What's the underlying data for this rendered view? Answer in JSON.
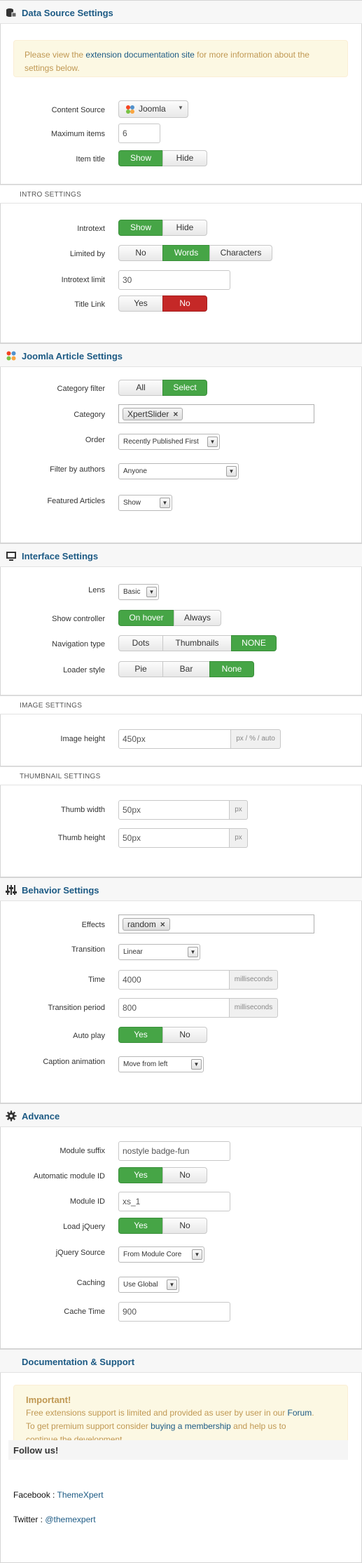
{
  "data_source": {
    "title": "Data Source Settings",
    "notice_pre": "Please view the",
    "notice_link": "extension documentation site",
    "notice_post_1": "for more information about the",
    "notice_post_2": "settings below.",
    "content_source_label": "Content Source",
    "content_source_value": "Joomla",
    "max_items_label": "Maximum items",
    "max_items_value": "6",
    "item_title_label": "Item title",
    "item_title_options": [
      "Show",
      "Hide"
    ],
    "item_title_selected": "Show"
  },
  "intro": {
    "title": "INTRO SETTINGS",
    "introtext_label": "Introtext",
    "introtext_options": [
      "Show",
      "Hide"
    ],
    "limited_by_label": "Limited by",
    "limited_by_options": [
      "No",
      "Words",
      "Characters"
    ],
    "limited_by_selected": "Words",
    "introtext_limit_label": "Introtext limit",
    "introtext_limit_value": "30",
    "title_link_label": "Title Link",
    "title_link_options": [
      "Yes",
      "No"
    ],
    "title_link_selected": "No"
  },
  "joomla": {
    "title": "Joomla Article Settings",
    "category_filter_label": "Category filter",
    "category_filter_options": [
      "All",
      "Select"
    ],
    "category_filter_selected": "Select",
    "category_label": "Category",
    "category_tag": "XpertSlider",
    "order_label": "Order",
    "order_value": "Recently Published First",
    "filter_authors_label": "Filter by authors",
    "filter_authors_value": "Anyone",
    "featured_label": "Featured Articles",
    "featured_value": "Show"
  },
  "interface": {
    "title": "Interface Settings",
    "lens_label": "Lens",
    "lens_value": "Basic",
    "show_controller_label": "Show controller",
    "show_controller_options": [
      "On hover",
      "Always"
    ],
    "show_controller_selected": "On hover",
    "navigation_label": "Navigation type",
    "navigation_options": [
      "Dots",
      "Thumbnails",
      "NONE"
    ],
    "navigation_selected": "NONE",
    "loader_label": "Loader style",
    "loader_options": [
      "Pie",
      "Bar",
      "None"
    ],
    "loader_selected": "None"
  },
  "image": {
    "title": "IMAGE SETTINGS",
    "height_label": "Image height",
    "height_value": "450px",
    "height_unit": "px / % / auto"
  },
  "thumbnail": {
    "title": "THUMBNAIL SETTINGS",
    "width_label": "Thumb width",
    "width_value": "50px",
    "width_unit": "px",
    "height_label": "Thumb height",
    "height_value": "50px",
    "height_unit": "px"
  },
  "behavior": {
    "title": "Behavior Settings",
    "effects_label": "Effects",
    "effects_tag": "random",
    "transition_label": "Transition",
    "transition_value": "Linear",
    "time_label": "Time",
    "time_value": "4000",
    "time_unit": "milliseconds",
    "period_label": "Transition period",
    "period_value": "800",
    "period_unit": "milliseconds",
    "autoplay_label": "Auto play",
    "autoplay_options": [
      "Yes",
      "No"
    ],
    "autoplay_selected": "Yes",
    "caption_label": "Caption animation",
    "caption_value": "Move from left"
  },
  "advance": {
    "title": "Advance",
    "suffix_label": "Module suffix",
    "suffix_value": "nostyle badge-fun",
    "auto_id_label": "Automatic module ID",
    "auto_id_options": [
      "Yes",
      "No"
    ],
    "module_id_label": "Module ID",
    "module_id_value": "xs_1",
    "load_jquery_label": "Load jQuery",
    "load_jquery_options": [
      "Yes",
      "No"
    ],
    "jquery_source_label": "jQuery Source",
    "jquery_source_value": "From Module Core",
    "caching_label": "Caching",
    "caching_value": "Use Global",
    "cache_time_label": "Cache Time",
    "cache_time_value": "900"
  },
  "docs": {
    "title": "Documentation & Support",
    "important": "Important!",
    "line1_pre": "Free extensions support is limited and provided as user by user in our",
    "line1_link": "Forum",
    "line2_pre": "To get premium support consider",
    "line2_link": "buying a membership",
    "line2_post": "and help us to",
    "line3": "continue the development.",
    "follow": "Follow us!",
    "facebook_label": "Facebook",
    "facebook_link": "ThemeXpert",
    "twitter_label": "Twitter",
    "twitter_link": "@themexpert"
  },
  "colors": {
    "accent": "#1c5a84",
    "green": "#46a546",
    "red": "#c52827",
    "notice_bg": "#fcf8e3",
    "notice_text": "#c09853"
  }
}
